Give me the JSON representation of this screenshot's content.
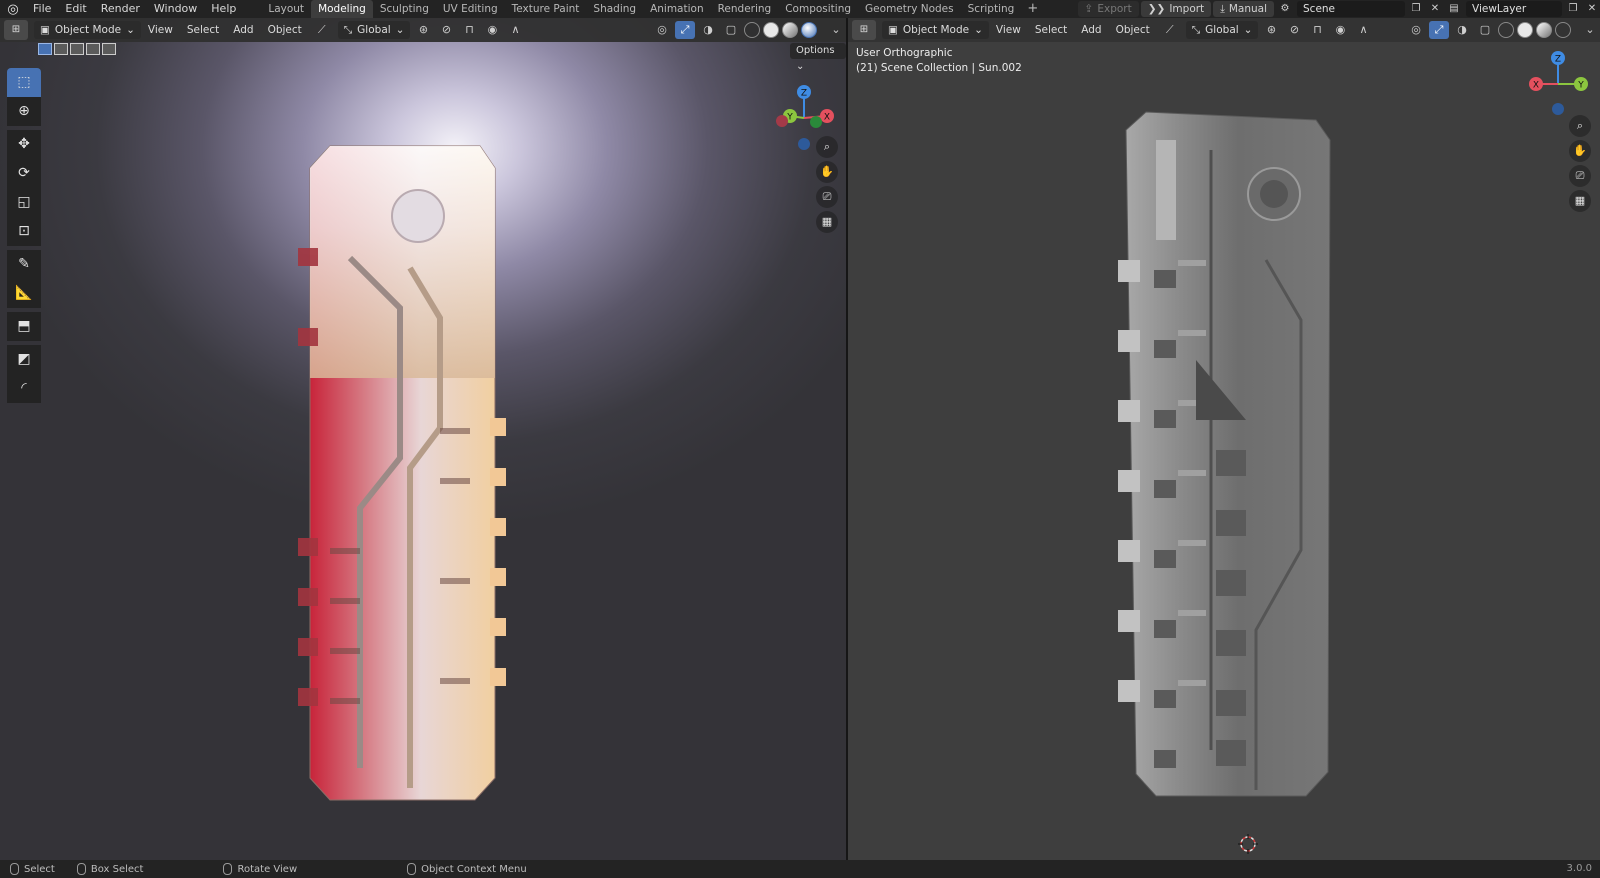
{
  "menu": {
    "items": [
      "File",
      "Edit",
      "Render",
      "Window",
      "Help"
    ]
  },
  "workspaces": {
    "tabs": [
      "Layout",
      "Modeling",
      "Sculpting",
      "UV Editing",
      "Texture Paint",
      "Shading",
      "Animation",
      "Rendering",
      "Compositing",
      "Geometry Nodes",
      "Scripting"
    ],
    "active": "Modeling",
    "add_label": "+"
  },
  "topright": {
    "export": "Export",
    "import": "Import",
    "manual": "Manual",
    "scene": "Scene",
    "view_layer": "ViewLayer"
  },
  "viewport_left": {
    "mode": "Object Mode",
    "menus": [
      "View",
      "Select",
      "Add",
      "Object"
    ],
    "orientation": "Global",
    "options": "Options",
    "gizmo": {
      "x": "X",
      "y": "Y",
      "z": "Z"
    }
  },
  "viewport_right": {
    "mode": "Object Mode",
    "menus": [
      "View",
      "Select",
      "Add",
      "Object"
    ],
    "orientation": "Global",
    "view_name": "User Orthographic",
    "collection_info": "(21) Scene Collection | Sun.002",
    "gizmo": {
      "x": "X",
      "y": "Y",
      "z": "Z"
    }
  },
  "statusbar": {
    "select": "Select",
    "box_select": "Box Select",
    "rotate_view": "Rotate View",
    "context_menu": "Object Context Menu",
    "version": "3.0.0"
  },
  "colors": {
    "accent": "#4772b3",
    "gizmo_x": "#e4505e",
    "gizmo_y": "#8cc63f",
    "gizmo_z": "#3f8ce4"
  }
}
